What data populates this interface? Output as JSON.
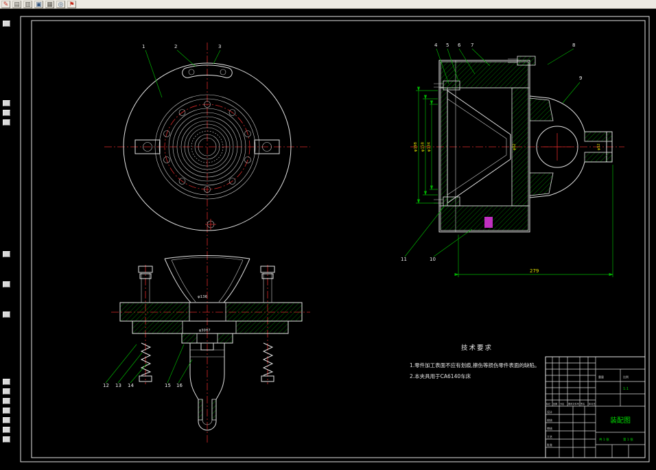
{
  "colors": {
    "canvas_bg": "#000000",
    "outline": "#e6e6e6",
    "hatch": "#00a000",
    "centerline": "#dd2a2a",
    "dimension_text": "#e3e300",
    "leader_green": "#00b400",
    "label_green": "#00d800",
    "toolbar_bg": "#ece9e2"
  },
  "toolbar": {
    "icons": [
      {
        "name": "pencil-icon",
        "glyph": "✎",
        "css": "color:#c42b1c"
      },
      {
        "name": "new-sheet-icon",
        "glyph": "▤",
        "css": "color:#55524a"
      },
      {
        "name": "open-sheet-icon",
        "glyph": "▥",
        "css": "color:#55524a"
      },
      {
        "name": "save-icon",
        "glyph": "▣",
        "css": "color:#33557f"
      },
      {
        "name": "grid-icon",
        "glyph": "▦",
        "css": "color:#55524a"
      },
      {
        "name": "zoom-icon",
        "glyph": "◎",
        "css": "color:#33557f"
      },
      {
        "name": "flag-icon",
        "glyph": "⚑",
        "css": "color:#c42b1c"
      }
    ]
  },
  "callouts": [
    "1",
    "2",
    "3",
    "4",
    "5",
    "6",
    "7",
    "8",
    "9",
    "10",
    "11",
    "12",
    "13",
    "14",
    "15",
    "16"
  ],
  "dims": {
    "d1": "φ198",
    "d2": "φ158",
    "d3": "φ134",
    "d4": "φ62",
    "d5": "φ52",
    "width": "279",
    "cone": "φ136",
    "shaft": "φ30H7"
  },
  "tech": {
    "title": "技术要求",
    "lines": [
      "1.零件加工表面不应有划痕,擦伤等损伤零件表面的缺陷。",
      "2.本夹具用于CA6140车床"
    ]
  },
  "title_block": {
    "name": "装配图",
    "rows": [
      "设计",
      "校核",
      "审核",
      "工艺",
      "批准"
    ],
    "headers": [
      "标记",
      "处数",
      "分区",
      "更改文件号",
      "签名",
      "年月日"
    ],
    "weight_label": "重量",
    "scale_label": "比例",
    "scale_value": "1:1",
    "sheet_total": "共 1 张",
    "sheet_no": "第 1 张"
  }
}
